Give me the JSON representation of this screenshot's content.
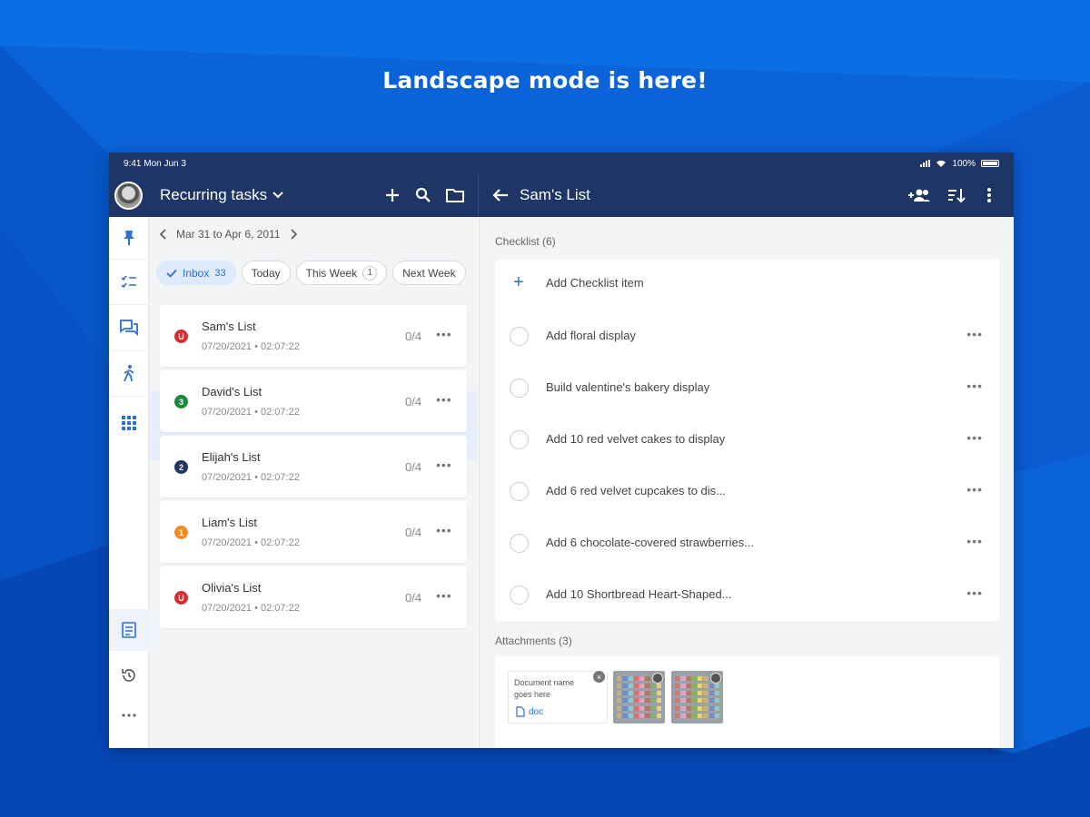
{
  "headline": "Landscape mode is here!",
  "status_bar": {
    "time": "9:41 Mon Jun 3",
    "battery": "100%"
  },
  "app_bar": {
    "list_title": "Recurring tasks",
    "detail_title": "Sam's List",
    "icons": [
      "add-icon",
      "search-icon",
      "folder-icon",
      "back-arrow-icon",
      "add-people-icon",
      "sort-icon",
      "more-vert-icon"
    ]
  },
  "rail": {
    "icons": [
      "pin-icon",
      "checklist-icon",
      "chat-icon",
      "walk-icon",
      "apps-grid-icon",
      "notes-icon",
      "history-icon",
      "more-horiz-icon"
    ]
  },
  "date_range": "Mar 31 to Apr 6, 2011",
  "filters": [
    {
      "label": "Inbox",
      "count": "33",
      "active": true
    },
    {
      "label": "Today"
    },
    {
      "label": "This Week",
      "count": "1"
    },
    {
      "label": "Next Week"
    }
  ],
  "lists": [
    {
      "name": "Sam's List",
      "meta": "07/20/2021 • 02:07:22",
      "progress": "0/4",
      "badge": "U",
      "color": "#d32f2f",
      "selected": true
    },
    {
      "name": "David's List",
      "meta": "07/20/2021 • 02:07:22",
      "progress": "0/4",
      "badge": "3",
      "color": "#1b8a3a"
    },
    {
      "name": "Elijah's List",
      "meta": "07/20/2021 • 02:07:22",
      "progress": "0/4",
      "badge": "2",
      "color": "#1f3566"
    },
    {
      "name": "Liam's List",
      "meta": "07/20/2021 • 02:07:22",
      "progress": "0/4",
      "badge": "1",
      "color": "#f08a24"
    },
    {
      "name": "Olivia's List",
      "meta": "07/20/2021 • 02:07:22",
      "progress": "0/4",
      "badge": "U",
      "color": "#d32f2f"
    }
  ],
  "checklist": {
    "label": "Checklist (6)",
    "add_label": "Add Checklist item",
    "items": [
      "Add floral display",
      "Build valentine's bakery display",
      "Add 10 red velvet cakes to display",
      "Add 6 red velvet cupcakes to dis...",
      "Add 6 chocolate-covered strawberries...",
      "Add 10 Shortbread Heart-Shaped..."
    ]
  },
  "attachments": {
    "label": "Attachments (3)",
    "doc_name": "Document name goes here",
    "doc_ext": "doc"
  },
  "colors": {
    "background": "#0a63d8",
    "appbar": "#1f3566",
    "accent": "#2c6fd6"
  }
}
